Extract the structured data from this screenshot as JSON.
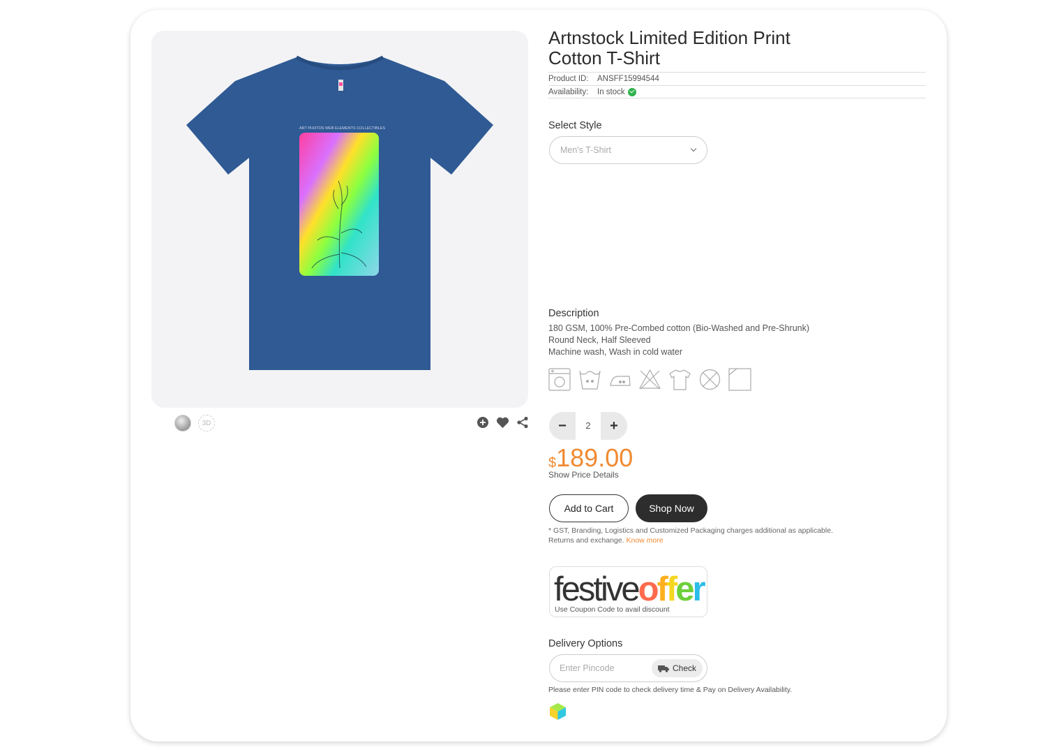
{
  "product": {
    "title_line1": "Artnstock Limited Edition Print",
    "title_line2": "Cotton T-Shirt",
    "id_label": "Product ID:",
    "id_value": "ANSFF15994544",
    "availability_label": "Availability:",
    "availability_value": "In stock",
    "shirt_color": "#2f5a94",
    "print_caption": "ART   PHOTOS   WEB ELEMENTS   COLLECTIBLES"
  },
  "thumbs": {
    "view3d": "3D"
  },
  "style": {
    "heading": "Select Style",
    "selected": "Men's T-Shirt"
  },
  "description": {
    "heading": "Description",
    "line1": "180 GSM, 100% Pre-Combed cotton (Bio-Washed and Pre-Shrunk)",
    "line2": "Round Neck, Half Sleeved",
    "line3": "Machine wash, Wash in cold water"
  },
  "care_icons": [
    "machine-wash-icon",
    "cold-wash-icon",
    "iron-icon",
    "no-bleach-icon",
    "shirt-care-icon",
    "no-tumble-dry-icon",
    "dry-flat-icon"
  ],
  "quantity": {
    "minus": "−",
    "value": "2",
    "plus": "+"
  },
  "price": {
    "currency": "$",
    "amount": "189.00",
    "details_link": "Show Price Details",
    "color": "#f08a32"
  },
  "actions": {
    "add_to_cart": "Add to Cart",
    "shop_now": "Shop Now"
  },
  "note": {
    "line1": "* GST, Branding, Logistics and Customized Packaging charges additional as applicable.",
    "line2": "Returns and exchange.",
    "know_more": "Know more"
  },
  "offer": {
    "word1": "festive",
    "letters": [
      "o",
      "f",
      "f",
      "e",
      "r"
    ],
    "subtext": "Use Coupon Code to avail discount"
  },
  "delivery": {
    "heading": "Delivery Options",
    "placeholder": "Enter Pincode",
    "check_label": "Check",
    "note": "Please enter PIN code to check delivery time & Pay on Delivery Availability."
  }
}
